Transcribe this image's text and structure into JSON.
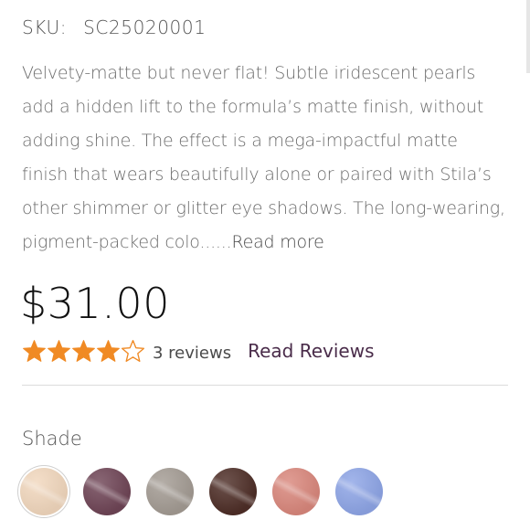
{
  "product": {
    "sku_label": "SKU:",
    "sku_value": "SC25020001",
    "description": "Velvety-matte but never flat! Subtle iridescent pearls add a hidden lift to the formula’s matte finish, without adding shine. The effect is a mega-impactful matte finish that wears beautifully alone or paired with Stila’s other shimmer or glitter eye shadows. The long-wearing, pigment-packed colo......",
    "read_more_label": "Read more",
    "price": "$31.00"
  },
  "rating": {
    "stars": 4,
    "max": 5,
    "review_count_text": "3 reviews",
    "read_reviews_label": "Read Reviews",
    "star_color": "#f08a24"
  },
  "shade": {
    "label": "Shade",
    "swatches": [
      {
        "color": "#f1d7bd",
        "selected": true
      },
      {
        "color": "#6f4556",
        "selected": false
      },
      {
        "color": "#a39b93",
        "selected": false
      },
      {
        "color": "#4e2e27",
        "selected": false
      },
      {
        "color": "#d9877c",
        "selected": false
      },
      {
        "color": "#8ea5e6",
        "selected": false
      }
    ]
  }
}
